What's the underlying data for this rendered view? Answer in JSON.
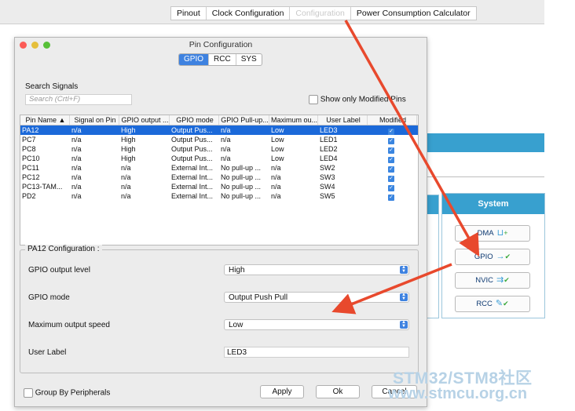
{
  "background_app": {
    "tabs": [
      "Pinout",
      "Clock Configuration",
      "Configuration",
      "Power Consumption Calculator"
    ],
    "system_panel": {
      "header": "System",
      "buttons": [
        {
          "label": "DMA",
          "icon": "dma-icon"
        },
        {
          "label": "GPIO",
          "icon": "gpio-icon"
        },
        {
          "label": "NVIC",
          "icon": "nvic-icon"
        },
        {
          "label": "RCC",
          "icon": "rcc-icon"
        }
      ]
    }
  },
  "dialog": {
    "title": "Pin Configuration",
    "tabs": [
      "GPIO",
      "RCC",
      "SYS"
    ],
    "active_tab": "GPIO",
    "search_label": "Search Signals",
    "search_placeholder": "Search (Crtl+F)",
    "show_modified_label": "Show only Modified Pins",
    "table": {
      "columns": [
        "Pin Name",
        "Signal on Pin",
        "GPIO output ...",
        "GPIO mode",
        "GPIO Pull-up...",
        "Maximum ou...",
        "User Label",
        "Modified"
      ],
      "rows": [
        {
          "pin": "PA12",
          "signal": "n/a",
          "output": "High",
          "mode": "Output Pus...",
          "pull": "n/a",
          "speed": "Low",
          "label": "LED3",
          "modified": true
        },
        {
          "pin": "PC7",
          "signal": "n/a",
          "output": "High",
          "mode": "Output Pus...",
          "pull": "n/a",
          "speed": "Low",
          "label": "LED1",
          "modified": true
        },
        {
          "pin": "PC8",
          "signal": "n/a",
          "output": "High",
          "mode": "Output Pus...",
          "pull": "n/a",
          "speed": "Low",
          "label": "LED2",
          "modified": true
        },
        {
          "pin": "PC10",
          "signal": "n/a",
          "output": "High",
          "mode": "Output Pus...",
          "pull": "n/a",
          "speed": "Low",
          "label": "LED4",
          "modified": true
        },
        {
          "pin": "PC11",
          "signal": "n/a",
          "output": "n/a",
          "mode": "External Int...",
          "pull": "No pull-up ...",
          "speed": "n/a",
          "label": "SW2",
          "modified": true
        },
        {
          "pin": "PC12",
          "signal": "n/a",
          "output": "n/a",
          "mode": "External Int...",
          "pull": "No pull-up ...",
          "speed": "n/a",
          "label": "SW3",
          "modified": true
        },
        {
          "pin": "PC13-TAM...",
          "signal": "n/a",
          "output": "n/a",
          "mode": "External Int...",
          "pull": "No pull-up ...",
          "speed": "n/a",
          "label": "SW4",
          "modified": true
        },
        {
          "pin": "PD2",
          "signal": "n/a",
          "output": "n/a",
          "mode": "External Int...",
          "pull": "No pull-up ...",
          "speed": "n/a",
          "label": "SW5",
          "modified": true
        }
      ]
    },
    "config": {
      "title": "PA12 Configuration :",
      "fields": [
        {
          "label": "GPIO output level",
          "value": "High"
        },
        {
          "label": "GPIO mode",
          "value": "Output Push Pull"
        },
        {
          "label": "Maximum output speed",
          "value": "Low"
        },
        {
          "label": "User Label",
          "value": "LED3"
        }
      ]
    },
    "group_by_label": "Group By Peripherals",
    "buttons": {
      "apply": "Apply",
      "ok": "Ok",
      "cancel": "Cancel"
    }
  },
  "watermark": {
    "line1": "STM32/STM8社区",
    "line2": "www.stmcu.org.cn"
  },
  "colors": {
    "accent": "#3e82e0",
    "selection": "#1b69d9",
    "header_blue": "#38a0cf",
    "annotation_arrow": "#e8492d"
  }
}
